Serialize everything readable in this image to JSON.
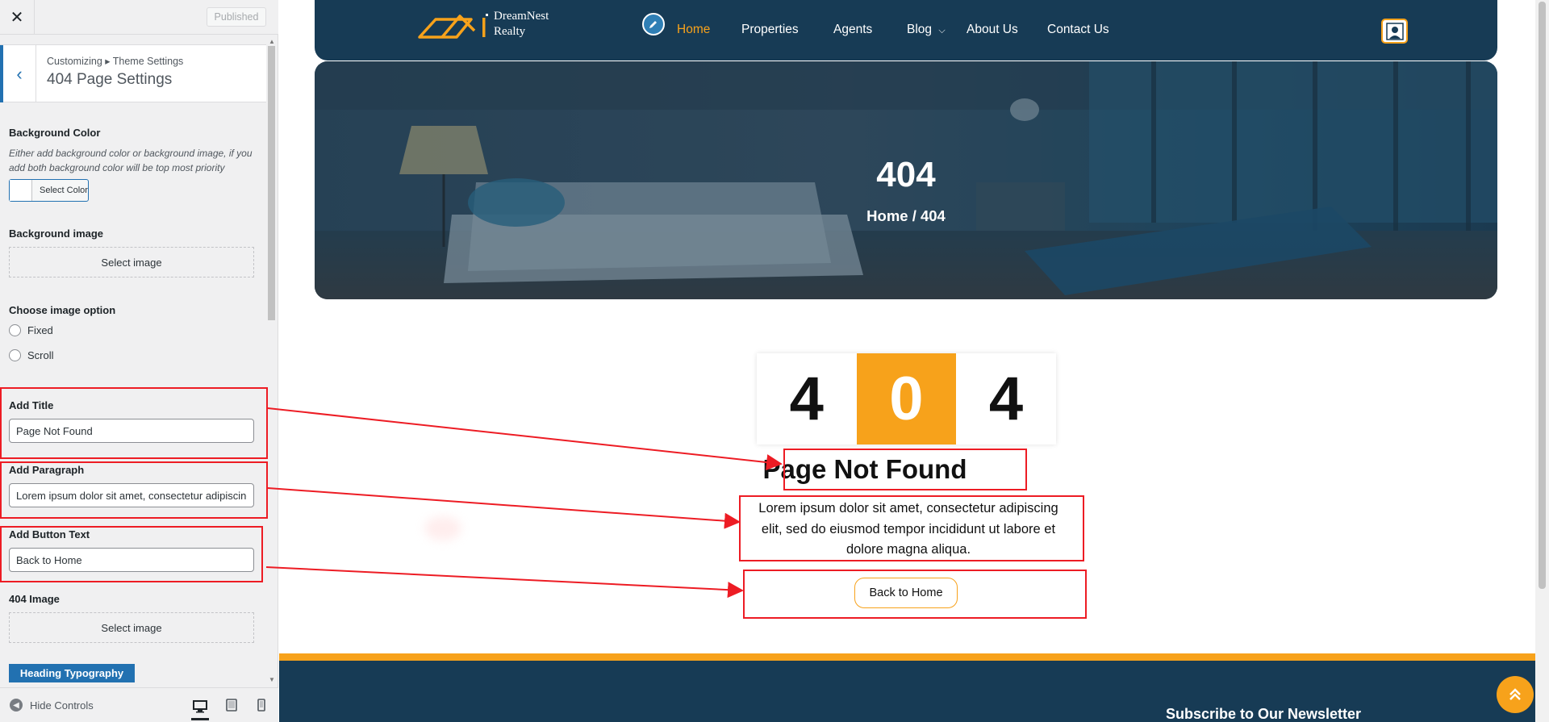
{
  "customizer": {
    "close_icon": "close-icon",
    "published_label": "Published",
    "breadcrumb": "Customizing ▸ Theme Settings",
    "section_title": "404 Page Settings",
    "bg_color": {
      "label": "Background Color",
      "description": "Either add background color or background image, if you add both background color will be top most priority",
      "button_label": "Select Color"
    },
    "bg_image": {
      "label": "Background image",
      "button_label": "Select image"
    },
    "image_option": {
      "label": "Choose image option",
      "options": [
        "Fixed",
        "Scroll"
      ]
    },
    "add_title": {
      "label": "Add Title",
      "value": "Page Not Found"
    },
    "add_paragraph": {
      "label": "Add Paragraph",
      "value": "Lorem ipsum dolor sit amet, consectetur adipiscing elit, sed do eiusmod tempor incididunt ut labore et dolore magna aliqua."
    },
    "add_button_text": {
      "label": "Add Button Text",
      "value": "Back to Home"
    },
    "image_404": {
      "label": "404 Image",
      "button_label": "Select image"
    },
    "heading_typography_label": "Heading Typography",
    "hide_controls_label": "Hide Controls",
    "devices": [
      "desktop-icon",
      "tablet-icon",
      "mobile-icon"
    ]
  },
  "site": {
    "logo_line1": "DreamNest",
    "logo_line2": "Realty",
    "nav": [
      "Home",
      "Properties",
      "Agents",
      "Blog",
      "About Us",
      "Contact Us"
    ],
    "active_nav": "Home",
    "hero_title": "404",
    "hero_breadcrumb": "Home / 404",
    "digits": [
      "4",
      "0",
      "4"
    ],
    "error_title": "Page Not Found",
    "error_paragraph": "Lorem ipsum dolor sit amet, consectetur adipiscing elit, sed do eiusmod tempor incididunt ut labore et dolore magna aliqua.",
    "error_button": "Back to Home",
    "footer_newsletter": "Subscribe to Our Newsletter"
  },
  "colors": {
    "navy": "#173b55",
    "accent": "#f7a21b",
    "wp_blue": "#2271b1",
    "annotation_red": "#ed1c24"
  }
}
